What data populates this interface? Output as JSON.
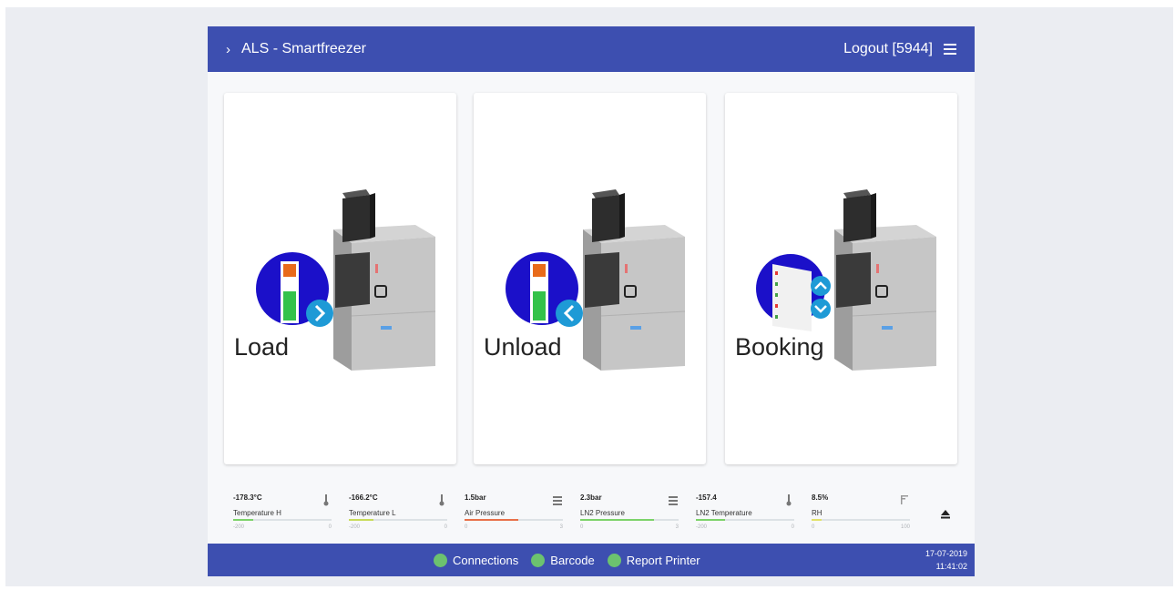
{
  "header": {
    "title": "ALS - Smartfreezer",
    "logout_label": "Logout [5944]"
  },
  "tiles": [
    {
      "label": "Load",
      "action_icon": "chevron-right-icon"
    },
    {
      "label": "Unload",
      "action_icon": "chevron-left-icon"
    },
    {
      "label": "Booking",
      "action_icon": "chevron-up-down-icon"
    }
  ],
  "sensors": [
    {
      "value": "-178.3°C",
      "name": "Temperature H",
      "min": "-200",
      "max": "0",
      "fill_fraction": 0.2,
      "bar_color": "#7cd36a",
      "icon": "thermometer-icon"
    },
    {
      "value": "-166.2°C",
      "name": "Temperature L",
      "min": "-200",
      "max": "0",
      "fill_fraction": 0.25,
      "bar_color": "#c8dc5a",
      "icon": "thermometer-icon"
    },
    {
      "value": "1.5bar",
      "name": "Air Pressure",
      "min": "0",
      "max": "3",
      "fill_fraction": 0.55,
      "bar_color": "#e8704a",
      "icon": "gauge-icon"
    },
    {
      "value": "2.3bar",
      "name": "LN2 Pressure",
      "min": "0",
      "max": "3",
      "fill_fraction": 0.75,
      "bar_color": "#7cd36a",
      "icon": "gauge-icon"
    },
    {
      "value": "-157.4",
      "name": "LN2 Temperature",
      "min": "-200",
      "max": "0",
      "fill_fraction": 0.3,
      "bar_color": "#7cd36a",
      "icon": "thermometer-icon"
    },
    {
      "value": "8.5%",
      "name": "RH",
      "min": "0",
      "max": "100",
      "fill_fraction": 0.1,
      "bar_color": "#e2e26a",
      "icon": "humidity-icon"
    }
  ],
  "footer": {
    "statuses": [
      {
        "label": "Connections",
        "color": "#6cc26f"
      },
      {
        "label": "Barcode",
        "color": "#6cc26f"
      },
      {
        "label": "Report Printer",
        "color": "#6cc26f"
      }
    ],
    "date": "17-07-2019",
    "time": "11:41:02"
  },
  "colors": {
    "accent": "#3d4fb0",
    "status_ok": "#6cc26f",
    "action_blue": "#1e9ad6"
  }
}
